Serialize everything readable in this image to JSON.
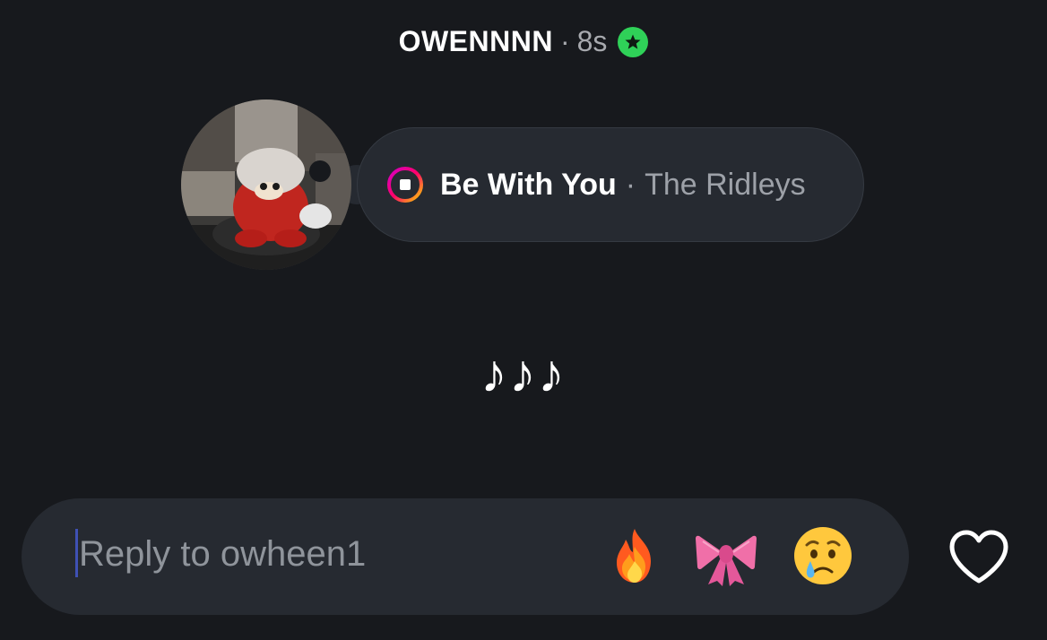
{
  "header": {
    "username": "OWENNNN",
    "separator": "·",
    "time": "8s",
    "badge_icon": "star-badge-icon",
    "badge_color": "#2fd158"
  },
  "avatar": {
    "alt_icon": "profile-avatar"
  },
  "music": {
    "icon": "music-stop-icon",
    "song": "Be With You",
    "separator": "·",
    "artist": "The Ridleys"
  },
  "message": {
    "text": "♪♪♪"
  },
  "reply": {
    "placeholder": "Reply to owheen1",
    "reactions": [
      {
        "name": "fire-emoji",
        "emoji": "🔥"
      },
      {
        "name": "ribbon-emoji",
        "emoji": "🎀"
      },
      {
        "name": "crying-emoji",
        "emoji": "😢"
      }
    ],
    "like_icon": "heart-icon"
  }
}
